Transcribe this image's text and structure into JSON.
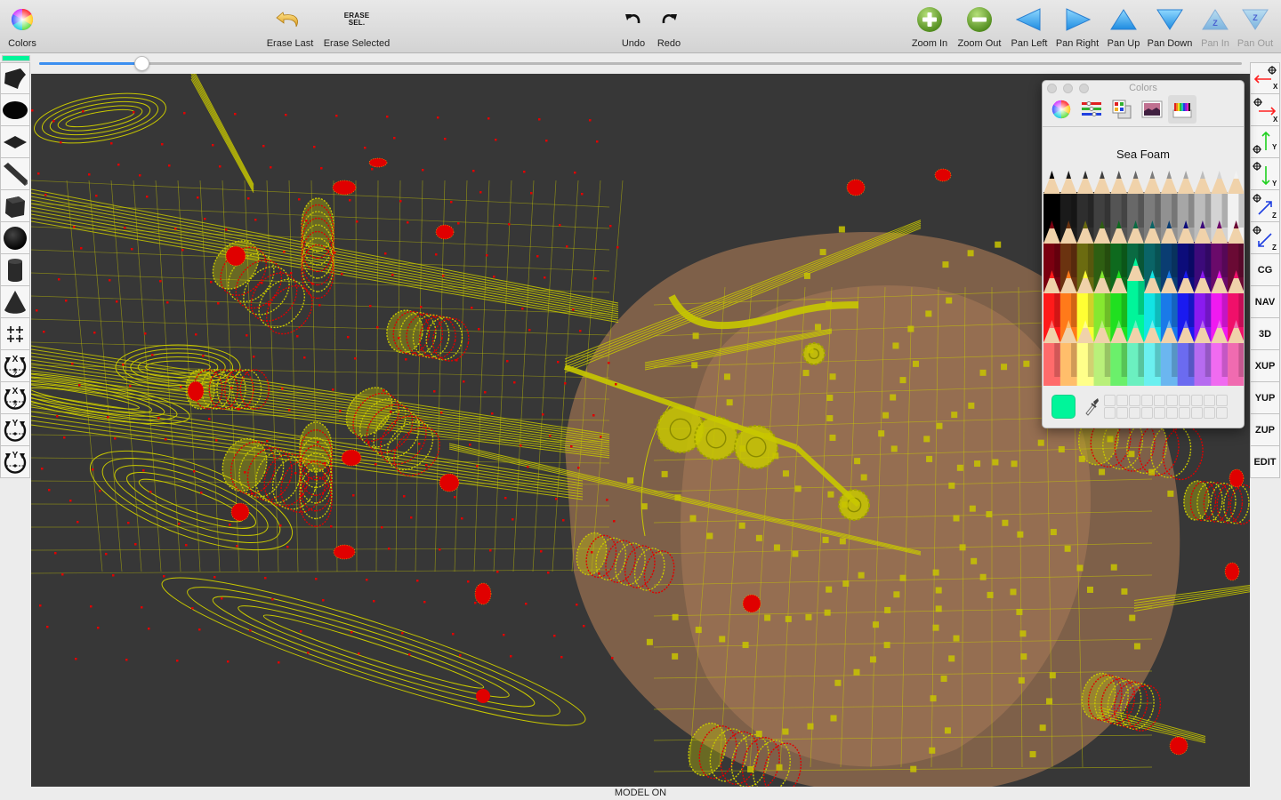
{
  "toolbar": {
    "colors": {
      "label": "Colors",
      "icon": "color-wheel-icon"
    },
    "erase_last": {
      "label": "Erase Last",
      "icon": "undo-arrow-icon"
    },
    "erase_selected": {
      "label": "Erase Selected",
      "icon_text_line1": "ERASE",
      "icon_text_line2": "SEL."
    },
    "undo": {
      "label": "Undo",
      "icon": "undo-icon"
    },
    "redo": {
      "label": "Redo",
      "icon": "redo-icon"
    },
    "zoom_in": {
      "label": "Zoom In",
      "icon": "plus-circle-icon"
    },
    "zoom_out": {
      "label": "Zoom Out",
      "icon": "minus-circle-icon"
    },
    "pan_left": {
      "label": "Pan Left",
      "icon": "triangle-left-icon"
    },
    "pan_right": {
      "label": "Pan Right",
      "icon": "triangle-right-icon"
    },
    "pan_up": {
      "label": "Pan Up",
      "icon": "triangle-up-icon"
    },
    "pan_down": {
      "label": "Pan Down",
      "icon": "triangle-down-icon"
    },
    "pan_in": {
      "label": "Pan In",
      "icon": "triangle-up-z-icon",
      "glyph": "Z",
      "disabled": true
    },
    "pan_out": {
      "label": "Pan Out",
      "icon": "triangle-down-z-icon",
      "glyph": "Z",
      "disabled": true
    }
  },
  "slider": {
    "value_fraction": 0.085,
    "current_color": "#00f59a"
  },
  "left_palette": [
    {
      "name": "surface-tool",
      "icon": "curved-surface-icon"
    },
    {
      "name": "ellipse-tool",
      "icon": "ellipse-icon"
    },
    {
      "name": "plane-tool",
      "icon": "diamond-plane-icon"
    },
    {
      "name": "wedge-tool",
      "icon": "bent-sheet-icon"
    },
    {
      "name": "cube-tool",
      "icon": "cube-icon"
    },
    {
      "name": "sphere-tool",
      "icon": "sphere-icon"
    },
    {
      "name": "cylinder-tool",
      "icon": "cylinder-icon"
    },
    {
      "name": "cone-tool",
      "icon": "cone-icon"
    },
    {
      "name": "move-tool",
      "icon": "four-plus-icon",
      "glyph": "++"
    },
    {
      "name": "rotate-xz-cw",
      "icon": "rotate-xz-icon",
      "axis_top": "X",
      "axis_bottom": "Z"
    },
    {
      "name": "rotate-xz-ccw",
      "icon": "rotate-xz-icon",
      "axis_top": "X",
      "axis_bottom": "Z"
    },
    {
      "name": "rotate-y-cw",
      "icon": "rotate-y-icon",
      "axis_top": "Y",
      "axis_bottom": ""
    },
    {
      "name": "rotate-y-ccw",
      "icon": "rotate-y-icon",
      "axis_top": "Y",
      "axis_bottom": ""
    }
  ],
  "right_palette": {
    "axis_buttons": [
      {
        "name": "move-neg-x",
        "axis": "X",
        "color": "#ff2020",
        "dir": "left"
      },
      {
        "name": "move-pos-x",
        "axis": "X",
        "color": "#ff2020",
        "dir": "right"
      },
      {
        "name": "move-pos-y",
        "axis": "Y",
        "color": "#20d020",
        "dir": "up"
      },
      {
        "name": "move-neg-y",
        "axis": "Y",
        "color": "#20d020",
        "dir": "down"
      },
      {
        "name": "move-pos-z",
        "axis": "Z",
        "color": "#2040e0",
        "dir": "upright"
      },
      {
        "name": "move-neg-z",
        "axis": "Z",
        "color": "#2040e0",
        "dir": "downleft"
      }
    ],
    "text_buttons": [
      "CG",
      "NAV",
      "3D",
      "XUP",
      "YUP",
      "ZUP",
      "EDIT"
    ]
  },
  "colors_panel": {
    "title": "Colors",
    "tabs": [
      {
        "name": "color-wheel",
        "icon": "color-wheel-icon"
      },
      {
        "name": "color-sliders",
        "icon": "sliders-icon"
      },
      {
        "name": "color-palettes",
        "icon": "palette-icon"
      },
      {
        "name": "image-palettes",
        "icon": "image-icon"
      },
      {
        "name": "pencils",
        "icon": "pencils-icon",
        "active": true
      }
    ],
    "selected_color_name": "Sea Foam",
    "selected_color": "#00f59a",
    "pencil_rows": [
      [
        "#000000",
        "#1a1a1a",
        "#2e2e2e",
        "#404040",
        "#545454",
        "#686868",
        "#7c7c7c",
        "#919191",
        "#a6a6a6",
        "#bcbcbc",
        "#d3d3d3",
        "#f2f2f2"
      ],
      [
        "#7a0010",
        "#6b3310",
        "#6b6b10",
        "#2e5e12",
        "#0e6a1e",
        "#0a6a42",
        "#0a6466",
        "#0a3d72",
        "#0c0c7a",
        "#3c0a7a",
        "#6a0a6a",
        "#6a0a34"
      ],
      [
        "#ff1a1a",
        "#ff7a1a",
        "#ffff33",
        "#86e830",
        "#20e020",
        "#00f59a",
        "#12e4e4",
        "#1a7ae8",
        "#1a1af0",
        "#8a1af0",
        "#f01af0",
        "#f0106a"
      ],
      [
        "#ff6b6b",
        "#ffbe6b",
        "#ffff8a",
        "#b9f07a",
        "#6bf06b",
        "#6bf0c0",
        "#6bf0f0",
        "#6bb6f0",
        "#6b6bf0",
        "#b66bf0",
        "#f06bf0",
        "#f06bb0"
      ]
    ],
    "selected_pencil": {
      "row": 2,
      "col": 5
    },
    "swatch_slots": 20
  },
  "viewport": {
    "background": "#373737",
    "wire_color": "#c8c800",
    "vertex_color": "#e00000",
    "solid_color": "#9a7050"
  },
  "status": {
    "text": "MODEL ON"
  }
}
